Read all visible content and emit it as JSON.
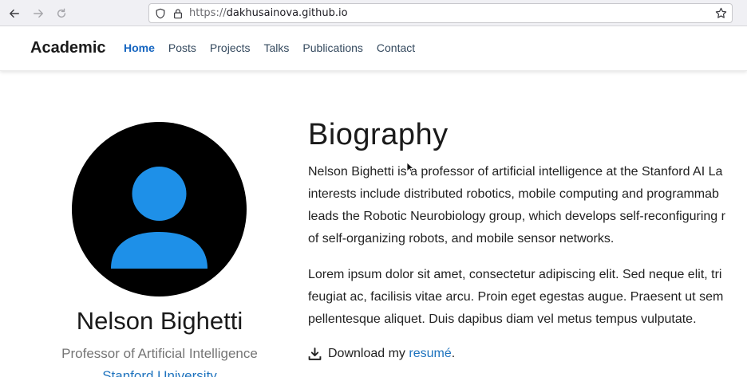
{
  "browser": {
    "url_prefix": "https://",
    "url_host": "dakhusainova.github.io"
  },
  "site": {
    "brand": "Academic",
    "nav": [
      "Home",
      "Posts",
      "Projects",
      "Talks",
      "Publications",
      "Contact"
    ],
    "active_nav": "Home"
  },
  "profile": {
    "name": "Nelson Bighetti",
    "role": "Professor of Artificial Intelligence",
    "organization": "Stanford University"
  },
  "biography": {
    "title": "Biography",
    "paragraph1": [
      "Nelson Bighetti is a professor of artificial intelligence at the Stanford AI La",
      "interests include distributed robotics, mobile computing and programmab",
      "leads the Robotic Neurobiology group, which develops self-reconfiguring r",
      "of self-organizing robots, and mobile sensor networks."
    ],
    "paragraph2": [
      "Lorem ipsum dolor sit amet, consectetur adipiscing elit. Sed neque elit, tri",
      "feugiat ac, facilisis vitae arcu. Proin eget egestas augue. Praesent ut sem",
      "pellentesque aliquet. Duis dapibus diam vel metus tempus vulputate."
    ],
    "download_prefix": "Download my ",
    "download_link": "resumé",
    "download_suffix": "."
  },
  "colors": {
    "accent": "#1565c0",
    "link": "#1e73be",
    "avatar_bg": "#000000",
    "avatar_figure": "#1e90e8"
  },
  "icons": {
    "back": "arrow-left-icon",
    "forward": "arrow-right-icon",
    "reload": "reload-icon",
    "shield": "shield-icon",
    "lock": "lock-icon",
    "bookmark": "star-icon",
    "download": "download-icon"
  }
}
